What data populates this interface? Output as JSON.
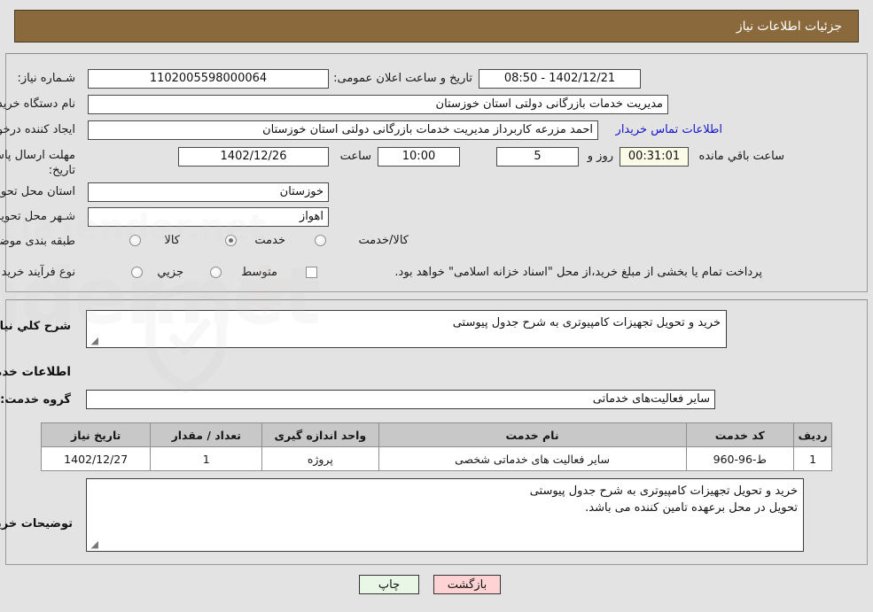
{
  "header": {
    "title": "جزئیات اطلاعات نیاز"
  },
  "top_section": {
    "need_number_label": "شـماره نیاز:",
    "need_number_value": "1102005598000064",
    "public_announce_label": "تاریخ و ساعت اعلان عمومی:",
    "public_announce_value": "1402/12/21 - 08:50",
    "buyer_org_label": "نام دستگاه خریدار:",
    "buyer_org_value": "مدیریت خدمات بازرگانی دولتی استان خوزستان",
    "requester_label": "ایجاد کننده درخواست:",
    "requester_value": "احمد مزرعه کاربرداز مدیریت خدمات بازرگانی دولتی استان خوزستان",
    "contact_link": "اطلاعات تماس خریدار",
    "deadline_label_line1": "مهلت ارسال پاسخ: تا",
    "deadline_label_line2": "تاریخ:",
    "deadline_date": "1402/12/26",
    "deadline_hour_label": "ساعت",
    "deadline_hour": "10:00",
    "remaining_days": "5",
    "remaining_days_label": "روز و",
    "remaining_time": "00:31:01",
    "remaining_time_label": "ساعت باقي مانده",
    "province_label": "استان محل تحویل:",
    "province_value": "خوزستان",
    "city_label": "شـهر محل تحویل:",
    "city_value": "اهواز",
    "category_label": "طبقه بندی موضوعی:",
    "category_options": [
      "کالا",
      "خدمت",
      "کالا/خدمت"
    ],
    "category_selected": 1,
    "purchase_type_label": "نوع فرآیند خرید :",
    "purchase_type_options": [
      "جزیي",
      "متوسط"
    ],
    "purchase_type_selected": -1,
    "treasury_checkbox_text": "پرداخت تمام یا بخشی از مبلغ خرید،از محل \"اسناد خزانه اسلامی\" خواهد بود.",
    "treasury_checked": false
  },
  "mid_section": {
    "general_desc_label": "شرح کلي نیاز:",
    "general_desc_value": "خرید و تحویل تجهیزات کامپیوتری به شرح جدول پیوستی",
    "services_info_heading": "اطلاعات خدمات مورد نیاز",
    "service_group_label": "گروه خدمت:",
    "service_group_value": "سایر فعالیت‌های خدماتی",
    "buyer_notes_label": "توضیحات خریدار:",
    "buyer_notes_value": "خرید و تحویل تجهیزات کامپیوتری به شرح جدول پیوستی\nتحویل در محل برعهده تامین کننده می باشد."
  },
  "table": {
    "headers": [
      "ردیف",
      "کد خدمت",
      "نام خدمت",
      "واحد اندازه گیری",
      "تعداد / مقدار",
      "تاریخ نیاز"
    ],
    "rows": [
      {
        "row_no": "1",
        "service_code": "ط-96-960",
        "service_name": "سایر فعالیت های خدماتی شخصی",
        "unit": "پروژه",
        "quantity": "1",
        "need_date": "1402/12/27"
      }
    ]
  },
  "footer": {
    "print_label": "چاپ",
    "back_label": "بازگشت"
  },
  "watermark": {
    "text": "AriaTender.net"
  },
  "colors": {
    "header_bg": "#8a6a3c",
    "page_bg": "#e3e3e3",
    "link": "#1414cc",
    "print_btn": "#e9f7e6",
    "back_btn": "#ffd3d3",
    "table_header_bg": "#c8c8c8"
  }
}
